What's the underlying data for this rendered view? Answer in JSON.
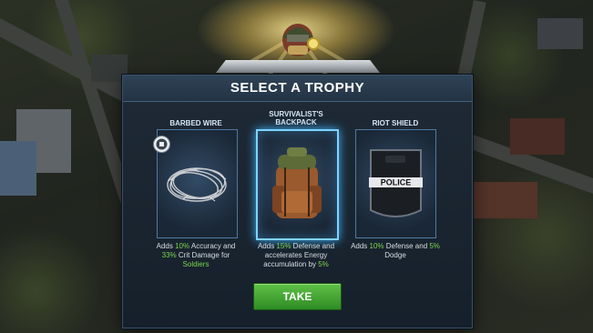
{
  "dialog": {
    "title": "SELECT A TROPHY",
    "take_label": "TAKE"
  },
  "trophies": [
    {
      "name": "BARBED WIRE",
      "icon": "barbed-wire-icon",
      "desc_1": "Adds ",
      "value_1": "10%",
      "desc_2": " Accuracy and ",
      "value_2": "33%",
      "desc_3": " Crit Damage for ",
      "value_3": "Soldiers",
      "selected": false
    },
    {
      "name": "SURVIVALIST'S BACKPACK",
      "icon": "backpack-icon",
      "desc_1": "Adds ",
      "value_1": "15%",
      "desc_2": " Defense and accelerates Energy accumulation by ",
      "value_2": "5%",
      "selected": true
    },
    {
      "name": "RIOT SHIELD",
      "icon": "riot-shield-icon",
      "shield_text": "POLICE",
      "desc_1": "Adds ",
      "value_1": "10%",
      "desc_2": " Defense and ",
      "value_2": "5%",
      "desc_3": " Dodge",
      "selected": false
    }
  ],
  "colors": {
    "highlight": "#7ed34d",
    "take_button": "#4aa83a",
    "selected_border": "#7fd3ff"
  }
}
